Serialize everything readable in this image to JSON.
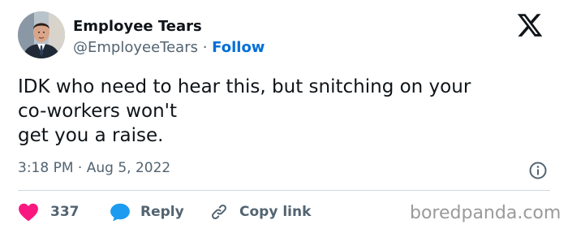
{
  "tweet": {
    "author_name": "Employee Tears",
    "handle": "@EmployeeTears",
    "separator": "·",
    "follow_label": "Follow",
    "text_lines": [
      "IDK who need to hear this, but snitching on your",
      "co-workers won't",
      "get you a raise."
    ],
    "time": "3:18 PM",
    "date": "Aug 5, 2022"
  },
  "actions": {
    "like_count": "337",
    "reply_label": "Reply",
    "copy_link_label": "Copy link"
  },
  "watermark": "boredpanda.com",
  "icons": {
    "logo": "x-logo-icon",
    "info": "info-icon",
    "like": "heart-icon",
    "reply": "speech-bubble-icon",
    "copy": "link-icon"
  },
  "colors": {
    "like": "#f91880",
    "reply": "#1d9bf0",
    "follow": "#006fd6",
    "muted_text": "#536471",
    "divider": "#cfd9de"
  }
}
